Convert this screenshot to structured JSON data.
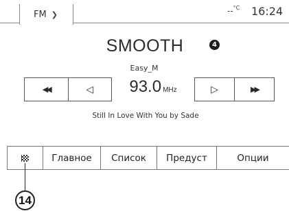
{
  "status_bar": {
    "source_label": "FM",
    "temperature": "--",
    "temperature_unit": "°C",
    "clock": "16:24"
  },
  "station": {
    "name": "SMOOTH",
    "preset_badge": "4",
    "ps_name": "Easy_M",
    "frequency": "93.0",
    "frequency_unit": "MHz",
    "radio_text": "Still In Love With You by Sade"
  },
  "controls": {
    "seek_back_icon": "◀◀",
    "step_back_icon": "◁",
    "step_forward_icon": "▷",
    "seek_forward_icon": "▶▶"
  },
  "tabs": {
    "flag_icon": "checkered-flag-icon",
    "main": "Главное",
    "list": "Список",
    "presets": "Предуст",
    "options": "Опции"
  },
  "callout": {
    "number": "14"
  }
}
